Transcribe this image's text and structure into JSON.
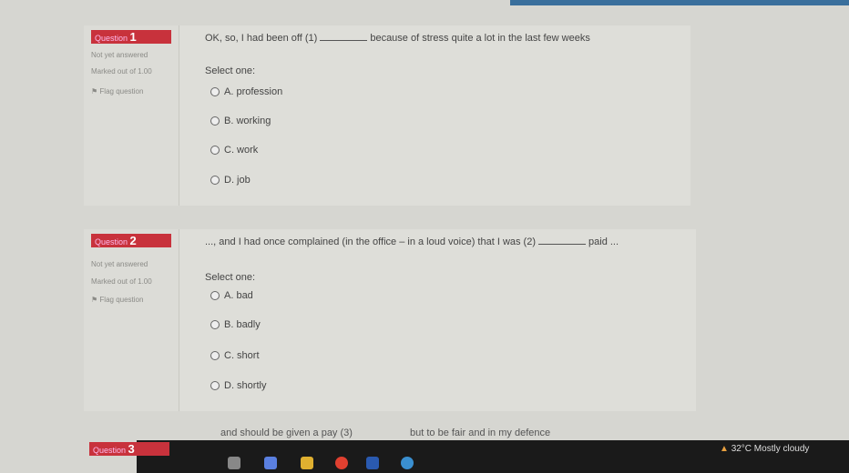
{
  "questions": [
    {
      "badge_prefix": "Question",
      "number": "1",
      "status": "Not yet answered",
      "marks": "Marked out of 1.00",
      "flag": "Flag question",
      "text_before": "OK, so, I had been off (1)",
      "text_after": "because of stress quite a lot in the last few weeks",
      "select_label": "Select one:",
      "options": [
        "A. profession",
        "B. working",
        "C. work",
        "D. job"
      ]
    },
    {
      "badge_prefix": "Question",
      "number": "2",
      "status": "Not yet answered",
      "marks": "Marked out of 1.00",
      "flag": "Flag question",
      "text_before": "..., and I had once complained (in the office – in a loud voice) that I was (2)",
      "text_after": "paid ...",
      "select_label": "Select one:",
      "options": [
        "A. bad",
        "B. badly",
        "C. short",
        "D. shortly"
      ]
    },
    {
      "badge_prefix": "Question",
      "number": "3",
      "text_before": "and should be given a pay (3)",
      "text_after": "but to be fair and in my defence"
    }
  ],
  "taskbar": {
    "weather": "32°C  Mostly cloudy",
    "icons": [
      "task-view-icon",
      "copilot-icon",
      "file-explorer-icon",
      "chrome-icon",
      "app-icon",
      "telegram-icon"
    ]
  },
  "colors": {
    "badge": "#c8323c",
    "taskbar": "#1a1a1a"
  }
}
